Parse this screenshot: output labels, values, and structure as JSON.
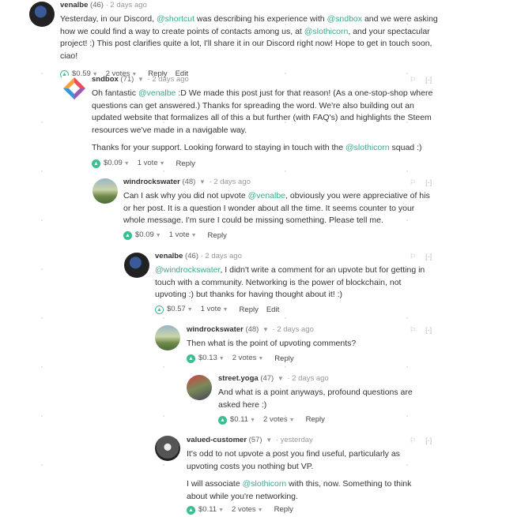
{
  "colors": {
    "mention": "#3aa98e",
    "upvote": "#3bbf8f"
  },
  "comments": [
    {
      "author": "venalbe",
      "rep": "(46)",
      "time": "2 days ago",
      "avatar": "dark-avatar",
      "paras": [
        [
          "Yesterday, in our Discord, ",
          "@shortcut",
          " was describing his experience with ",
          "@sndbox",
          " and we were asking how we could find a way to create points of contacts among us, at ",
          "@slothicorn",
          ", and your spectacular project! :) This post clarifies quite a lot, I'll share it in our Discord right now! Hope to get in touch soon, ciao!"
        ]
      ],
      "payout": "$0.59",
      "votes": "2 votes",
      "reply": "Reply",
      "edit": "Edit",
      "upvoted": false
    },
    {
      "author": "sndbox",
      "rep": "(71)",
      "time": "2 days ago",
      "avatar": "logo-avatar",
      "paras": [
        [
          "Oh fantastic ",
          "@venalbe",
          " :D We made this post just for that reason! (As a one-stop-shop where questions can get answered.) Thanks for spreading the word. We're also building out an updated website that formalizes all of this a but further (with FAQ's) and highlights the Steem resources we've made in a navigable way."
        ],
        [
          "Thanks for your support. Looking forward to staying in touch with the ",
          "@slothicorn",
          " squad :)"
        ]
      ],
      "payout": "$0.09",
      "votes": "1 vote",
      "reply": "Reply",
      "edit": "",
      "upvoted": true
    },
    {
      "author": "windrockswater",
      "rep": "(48)",
      "time": "2 days ago",
      "avatar": "landscape-avatar",
      "paras": [
        [
          "Can I ask why you did not upvote ",
          "@venalbe",
          ", obviously you were appreciative of his or her post. It is a question I wonder about all the time. It seems counter to your whole message. I'm sure I could be missing something. Please tell me."
        ]
      ],
      "payout": "$0.09",
      "votes": "1 vote",
      "reply": "Reply",
      "edit": "",
      "upvoted": true
    },
    {
      "author": "venalbe",
      "rep": "(46)",
      "time": "2 days ago",
      "avatar": "dark-avatar",
      "paras": [
        [
          "",
          "@windrockswater",
          ", I didn't write a comment for an upvote but for getting in touch with a community. Networking is the power of blockchain, not upvoting :) but thanks for having thought about it! :)"
        ]
      ],
      "payout": "$0.57",
      "votes": "1 vote",
      "reply": "Reply",
      "edit": "Edit",
      "upvoted": false
    },
    {
      "author": "windrockswater",
      "rep": "(48)",
      "time": "2 days ago",
      "avatar": "landscape-avatar",
      "paras": [
        [
          "Then what is the point of upvoting comments?"
        ]
      ],
      "payout": "$0.13",
      "votes": "2 votes",
      "reply": "Reply",
      "edit": "",
      "upvoted": true
    },
    {
      "author": "street.yoga",
      "rep": "(47)",
      "time": "2 days ago",
      "avatar": "yoga-avatar",
      "paras": [
        [
          "And what is a point anyways, profound questions are asked here :)"
        ]
      ],
      "payout": "$0.11",
      "votes": "2 votes",
      "reply": "Reply",
      "edit": "",
      "upvoted": true
    },
    {
      "author": "valued-customer",
      "rep": "(57)",
      "time": "yesterday",
      "avatar": "gray-avatar",
      "paras": [
        [
          "It's odd to not upvote a post you find useful, particularly as upvoting costs you nothing but VP."
        ],
        [
          "I will associate ",
          "@slothicorn",
          " with this, now. Something to think about while you're networking."
        ]
      ],
      "payout": "$0.11",
      "votes": "2 votes",
      "reply": "Reply",
      "edit": "",
      "upvoted": true
    }
  ],
  "icons": {
    "flag": "flag-icon",
    "collapse": "[-]",
    "caret": "▾",
    "upvote": "upvote-icon"
  }
}
